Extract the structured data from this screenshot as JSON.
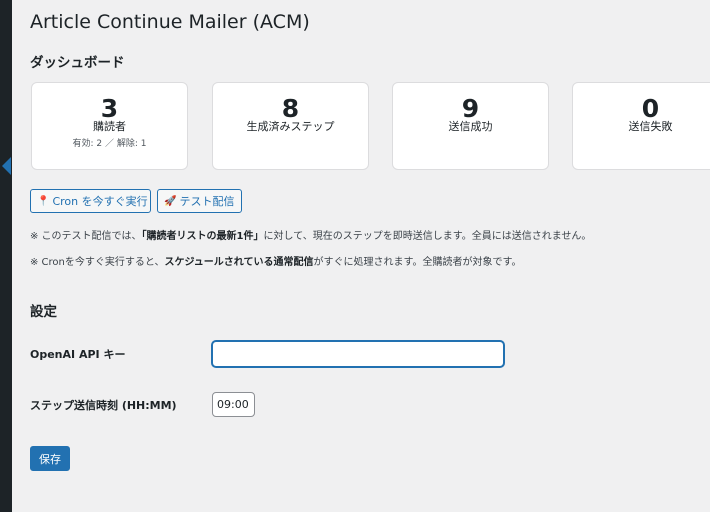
{
  "page": {
    "title": "Article Continue Mailer (ACM)"
  },
  "dashboard": {
    "heading": "ダッシュボード",
    "cards": [
      {
        "value": "3",
        "label": "購読者",
        "sub": "有効: 2 ／ 解除: 1"
      },
      {
        "value": "8",
        "label": "生成済みステップ"
      },
      {
        "value": "9",
        "label": "送信成功"
      },
      {
        "value": "0",
        "label": "送信失敗"
      }
    ]
  },
  "actions": {
    "cron_icon": "pushpin-icon",
    "cron_label": "Cron を今すぐ実行",
    "test_icon": "rocket-icon",
    "test_label": "テスト配信"
  },
  "notes": {
    "note1_prefix": "※ このテスト配信では、",
    "note1_bold": "「購読者リストの最新1件」",
    "note1_suffix": "に対して、現在のステップを即時送信します。全員には送信されません。",
    "note2_prefix": "※ Cronを今すぐ実行すると、",
    "note2_bold": "スケジュールされている通常配信",
    "note2_suffix": "がすぐに処理されます。全購読者が対象です。"
  },
  "settings": {
    "heading": "設定",
    "api_key_label": "OpenAI API キー",
    "api_key_value": "",
    "step_time_label": "ステップ送信時刻 (HH:MM)",
    "step_time_value": "09:00",
    "save_label": "保存"
  },
  "colors": {
    "accent": "#2271b1",
    "background": "#f0f0f1",
    "admin_bar": "#1d2327"
  }
}
